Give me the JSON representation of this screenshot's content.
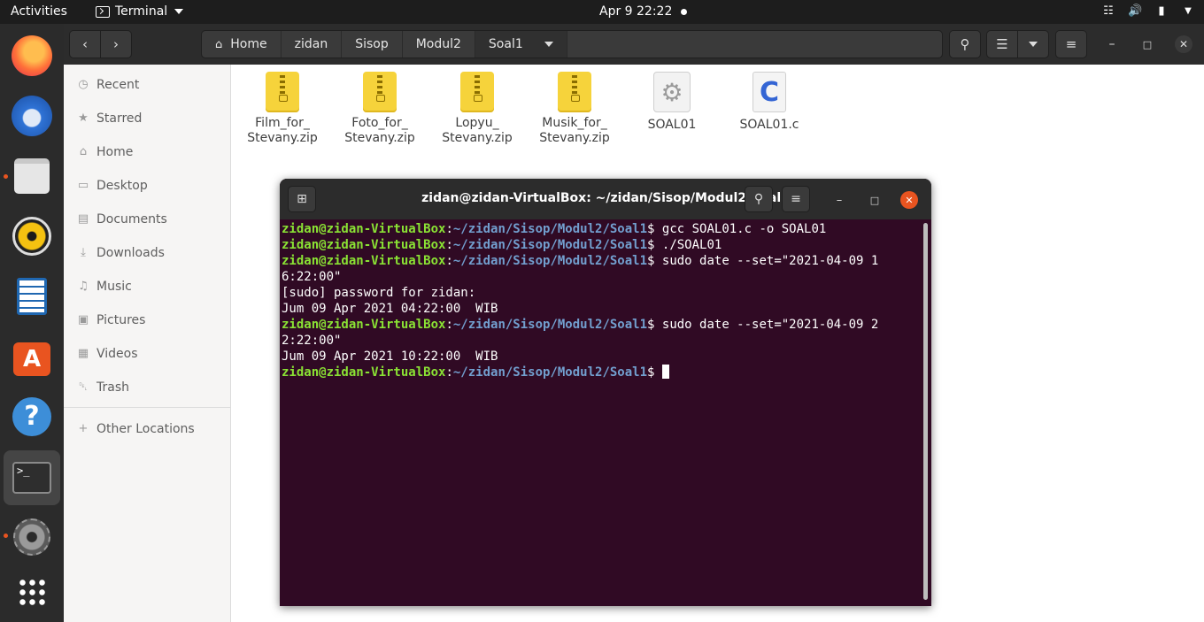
{
  "topbar": {
    "activities": "Activities",
    "app_name": "Terminal",
    "clock": "Apr 9  22:22"
  },
  "dock": {
    "apps": [
      "firefox-icon",
      "thunderbird-icon",
      "files-icon",
      "rhythmbox-icon",
      "writer-icon",
      "software-icon",
      "help-icon",
      "terminal-icon",
      "settings-icon",
      "show-apps-icon"
    ]
  },
  "files": {
    "breadcrumbs": [
      "Home",
      "zidan",
      "Sisop",
      "Modul2",
      "Soal1"
    ],
    "sidebar": [
      {
        "label": "Recent",
        "icon": "clock-icon"
      },
      {
        "label": "Starred",
        "icon": "star-icon"
      },
      {
        "label": "Home",
        "icon": "home-icon"
      },
      {
        "label": "Desktop",
        "icon": "desktop-icon"
      },
      {
        "label": "Documents",
        "icon": "document-icon"
      },
      {
        "label": "Downloads",
        "icon": "download-icon"
      },
      {
        "label": "Music",
        "icon": "music-icon"
      },
      {
        "label": "Pictures",
        "icon": "picture-icon"
      },
      {
        "label": "Videos",
        "icon": "video-icon"
      },
      {
        "label": "Trash",
        "icon": "trash-icon"
      }
    ],
    "other_locations": "Other Locations",
    "items": [
      {
        "line1": "Film_for_",
        "line2": "Stevany.zip",
        "type": "zip"
      },
      {
        "line1": "Foto_for_",
        "line2": "Stevany.zip",
        "type": "zip"
      },
      {
        "line1": "Lopyu_",
        "line2": "Stevany.zip",
        "type": "zip"
      },
      {
        "line1": "Musik_for_",
        "line2": "Stevany.zip",
        "type": "zip"
      },
      {
        "line1": "SOAL01",
        "line2": "",
        "type": "executable"
      },
      {
        "line1": "SOAL01.c",
        "line2": "",
        "type": "c-source"
      }
    ]
  },
  "terminal": {
    "title": "zidan@zidan-VirtualBox: ~/zidan/Sisop/Modul2/Soal1",
    "prompt_user": "zidan@zidan-VirtualBox",
    "prompt_path": "~/zidan/Sisop/Modul2/Soal1",
    "lines": [
      {
        "type": "cmd",
        "text": "gcc SOAL01.c -o SOAL01"
      },
      {
        "type": "cmd",
        "text": "./SOAL01"
      },
      {
        "type": "cmd",
        "text": "sudo date --set=\"2021-04-09 1"
      },
      {
        "type": "out",
        "text": "6:22:00\""
      },
      {
        "type": "out",
        "text": "[sudo] password for zidan:"
      },
      {
        "type": "out",
        "text": "Jum 09 Apr 2021 04:22:00  WIB"
      },
      {
        "type": "cmd",
        "text": "sudo date --set=\"2021-04-09 2"
      },
      {
        "type": "out",
        "text": "2:22:00\""
      },
      {
        "type": "out",
        "text": "Jum 09 Apr 2021 10:22:00  WIB"
      },
      {
        "type": "cmd",
        "text": ""
      }
    ]
  }
}
